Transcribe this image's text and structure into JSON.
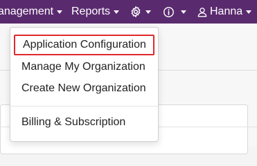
{
  "navbar": {
    "background": "#5a2a6e",
    "management_label": "anagement",
    "reports_label": "Reports",
    "settings_icon": "gear-icon",
    "info_icon": "info-icon",
    "user_icon": "user-icon",
    "user_label": "Hanna"
  },
  "dropdown": {
    "items": [
      {
        "label": "Application Configuration",
        "highlighted": true
      },
      {
        "label": "Manage My Organization"
      },
      {
        "label": "Create New Organization"
      },
      {
        "label": "Billing & Subscription"
      }
    ],
    "highlight_color": "#e0282c"
  }
}
